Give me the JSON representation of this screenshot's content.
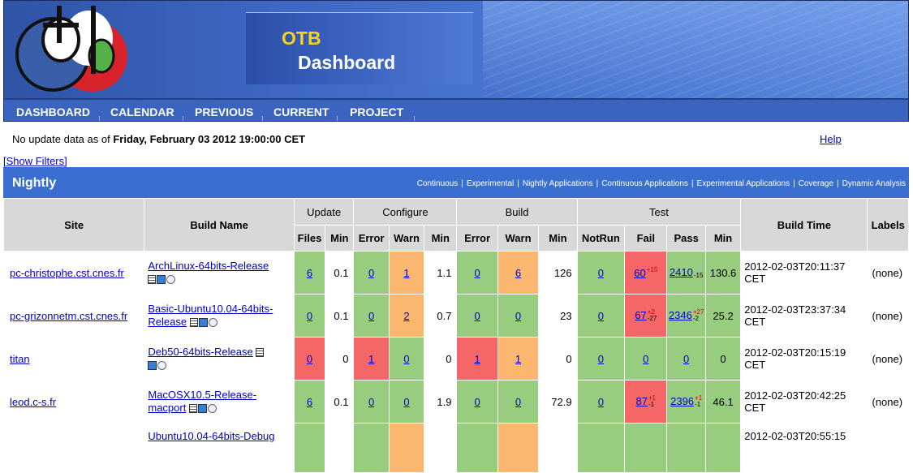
{
  "header": {
    "title_top": "OTB",
    "title_bottom": "Dashboard",
    "nav": [
      "DASHBOARD",
      "CALENDAR",
      "PREVIOUS",
      "CURRENT",
      "PROJECT"
    ]
  },
  "info": {
    "update_prefix": "No update data as of",
    "update_date": "Friday, February 03 2012 19:00:00 CET",
    "help": "Help",
    "filters": "[Show Filters]"
  },
  "section": {
    "title": "Nightly",
    "links": [
      "Continuous",
      "Experimental",
      "Nightly Applications",
      "Continuous Applications",
      "Experimental Applications",
      "Coverage",
      "Dynamic Analysis"
    ]
  },
  "table": {
    "headers": {
      "site": "Site",
      "build_name": "Build Name",
      "update": "Update",
      "configure": "Configure",
      "build": "Build",
      "test": "Test",
      "build_time": "Build Time",
      "labels": "Labels",
      "files": "Files",
      "min": "Min",
      "error": "Error",
      "warn": "Warn",
      "notrun": "NotRun",
      "fail": "Fail",
      "pass": "Pass"
    },
    "rows": [
      {
        "site": "pc-christophe.cst.cnes.fr",
        "build": "ArchLinux-64bits-Release",
        "upd_files": "6",
        "upd_min": "0.1",
        "cfg_err": "0",
        "cfg_warn": "1",
        "cfg_min": "1.1",
        "b_err": "0",
        "b_warn": "6",
        "b_min": "126",
        "notrun": "0",
        "fail": "60",
        "fail_up": "+15",
        "fail_down": "",
        "pass": "2410",
        "pass_up": "",
        "pass_down": "-15",
        "t_min": "130.6",
        "time": "2012-02-03T20:11:37",
        "tz": "CET",
        "labels": "(none)"
      },
      {
        "site": "pc-grizonnetm.cst.cnes.fr",
        "build": "Basic-Ubuntu10.04-64bits-Release",
        "upd_files": "0",
        "upd_min": "0.1",
        "cfg_err": "0",
        "cfg_warn": "2",
        "cfg_min": "0.7",
        "b_err": "0",
        "b_warn": "0",
        "b_min": "23",
        "notrun": "0",
        "fail": "67",
        "fail_up": "+2",
        "fail_down": "-27",
        "pass": "2346",
        "pass_up": "+27",
        "pass_down": "-2",
        "t_min": "25.2",
        "time": "2012-02-03T23:37:34",
        "tz": "CET",
        "labels": "(none)"
      },
      {
        "site": "titan",
        "build": "Deb50-64bits-Release",
        "upd_files": "0",
        "upd_min": "0",
        "cfg_err": "1",
        "cfg_warn": "0",
        "cfg_min": "0",
        "b_err": "1",
        "b_warn": "1",
        "b_min": "0",
        "notrun": "0",
        "fail": "0",
        "fail_up": "",
        "fail_down": "",
        "pass": "0",
        "pass_up": "",
        "pass_down": "",
        "t_min": "0",
        "time": "2012-02-03T20:15:19",
        "tz": "CET",
        "labels": "(none)"
      },
      {
        "site": "leod.c-s.fr",
        "build": "MacOSX10.5-Release-macport",
        "upd_files": "6",
        "upd_min": "0.1",
        "cfg_err": "0",
        "cfg_warn": "0",
        "cfg_min": "1.9",
        "b_err": "0",
        "b_warn": "0",
        "b_min": "72.9",
        "notrun": "0",
        "fail": "87",
        "fail_up": "+1",
        "fail_down": "-1",
        "pass": "2396",
        "pass_up": "+1",
        "pass_down": "-1",
        "t_min": "46.1",
        "time": "2012-02-03T20:42:25",
        "tz": "CET",
        "labels": "(none)"
      },
      {
        "site": "",
        "build": "Ubuntu10.04-64bits-Debug",
        "upd_files": "",
        "upd_min": "",
        "cfg_err": "",
        "cfg_warn": "",
        "cfg_min": "",
        "b_err": "",
        "b_warn": "",
        "b_min": "",
        "notrun": "",
        "fail": "",
        "fail_up": "",
        "fail_down": "",
        "pass": "",
        "pass_up": "",
        "pass_down": "",
        "t_min": "",
        "time": "2012-02-03T20:55:15",
        "tz": "",
        "labels": ""
      }
    ]
  },
  "colors": {
    "green": "#98cc7f",
    "red": "#f56766",
    "orange": "#fbb670",
    "section": "#3a6fd1"
  }
}
